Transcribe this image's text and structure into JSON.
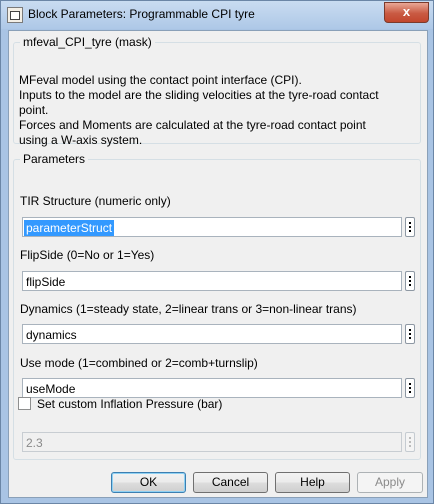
{
  "window": {
    "title": "Block Parameters: Programmable CPI tyre",
    "close_glyph": "x"
  },
  "mask": {
    "legend": "mfeval_CPI_tyre (mask)",
    "description": [
      "MFeval model using the contact point interface (CPI).",
      "Inputs to the model are the sliding velocities at the tyre-road contact",
      "point.",
      "Forces and Moments are calculated at the tyre-road contact point",
      "using a W-axis system."
    ]
  },
  "parameters": {
    "legend": "Parameters",
    "tir": {
      "label": "TIR Structure (numeric only)",
      "value": "parameterStruct"
    },
    "flip": {
      "label": "FlipSide (0=No or  1=Yes)",
      "value": "flipSide"
    },
    "dynamics": {
      "label": "Dynamics (1=steady state, 2=linear trans or 3=non-linear trans)",
      "value": "dynamics"
    },
    "usemode": {
      "label": "Use mode (1=combined or 2=comb+turnslip)",
      "value": "useMode"
    },
    "pressure": {
      "checkbox_label": "Set custom Inflation Pressure (bar)",
      "checked": false,
      "value": "2.3"
    }
  },
  "buttons": {
    "ok": "OK",
    "cancel": "Cancel",
    "help": "Help",
    "apply": "Apply"
  },
  "colors": {
    "titlebar": "#aec8e7",
    "close": "#c95a43",
    "selection": "#3399ff",
    "dialog": "#f0f0f0"
  }
}
